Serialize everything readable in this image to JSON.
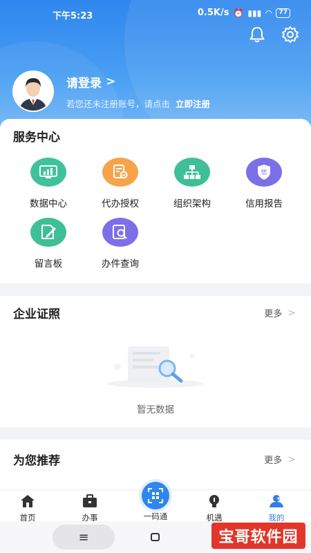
{
  "status_bar": {
    "time": "下午5:23",
    "network_speed": "0.5K/s",
    "battery": "77"
  },
  "header": {
    "login_text": "请登录",
    "login_chevron": ">",
    "hint": "若您还未注册账号，请点击",
    "register_link": "立即注册",
    "icons": [
      "bell-icon",
      "gear-icon"
    ]
  },
  "service_center": {
    "title": "服务中心",
    "items": [
      {
        "label": "数据中心",
        "icon": "data-chart-icon",
        "color": "#3fc29a"
      },
      {
        "label": "代办授权",
        "icon": "authorization-icon",
        "color": "#f5a44a"
      },
      {
        "label": "组织架构",
        "icon": "org-chart-icon",
        "color": "#3fbf95"
      },
      {
        "label": "信用报告",
        "icon": "credit-shield-icon",
        "color": "#7d6fe8"
      },
      {
        "label": "留言板",
        "icon": "message-board-icon",
        "color": "#3fbf95"
      },
      {
        "label": "办件查询",
        "icon": "search-document-icon",
        "color": "#7d6fe8"
      }
    ]
  },
  "license_section": {
    "title": "企业证照",
    "more": "更多",
    "empty_text": "暂无数据"
  },
  "recommend_section": {
    "title": "为您推荐",
    "more": "更多"
  },
  "tabbar": {
    "tabs": [
      {
        "label": "首页",
        "icon": "home-icon"
      },
      {
        "label": "办事",
        "icon": "briefcase-icon"
      },
      {
        "label": "一码通",
        "icon": "qr-scan-icon"
      },
      {
        "label": "机遇",
        "icon": "lightbulb-icon"
      },
      {
        "label": "我的",
        "icon": "user-icon"
      }
    ],
    "active": "我的",
    "active_color": "#2f7fe8"
  },
  "system_nav": {
    "home": "≡",
    "recents": "▢"
  },
  "watermark": "宝哥软件园"
}
